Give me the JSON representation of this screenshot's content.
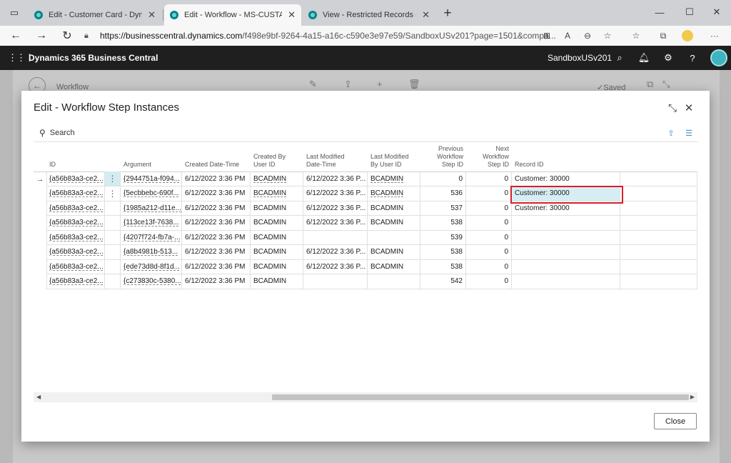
{
  "browser": {
    "tabs": [
      {
        "title": "Edit - Customer Card - Dynamics",
        "active": false
      },
      {
        "title": "Edit - Workflow - MS-CUSTAW-W",
        "active": true
      },
      {
        "title": "View - Restricted Records - Dyna",
        "active": false
      }
    ],
    "url_host": "https://businesscentral.dynamics.com",
    "url_path": "/f498e9bf-9264-4a15-a16c-c590e3e97e59/SandboxUSv201?page=1501&compa..."
  },
  "bc": {
    "app_name": "Dynamics 365 Business Central",
    "environment": "SandboxUSv201"
  },
  "background_page": {
    "title": "Workflow",
    "saved_label": "Saved"
  },
  "dialog": {
    "title": "Edit - Workflow Step Instances",
    "search_label": "Search",
    "close_label": "Close",
    "columns": [
      "ID",
      "Argument",
      "Created Date-Time",
      "Created By\nUser ID",
      "Last Modified\nDate-Time",
      "Last Modified\nBy User ID",
      "Previous\nWorkflow\nStep ID",
      "Next\nWorkflow\nStep ID",
      "Record ID"
    ],
    "rows": [
      {
        "id": "{a56b83a3-ce2...",
        "argument": "{2944751a-f094...",
        "created": "6/12/2022 3:36 PM",
        "created_by": "BCADMIN",
        "modified": "6/12/2022 3:36 P...",
        "modified_by": "BCADMIN",
        "prev": "0",
        "next": "0",
        "record": "Customer: 30000"
      },
      {
        "id": "{a56b83a3-ce2...",
        "argument": "{5ecbbebc-690f...",
        "created": "6/12/2022 3:36 PM",
        "created_by": "BCADMIN",
        "modified": "6/12/2022 3:36 P...",
        "modified_by": "BCADMIN",
        "prev": "536",
        "next": "0",
        "record": "Customer: 30000"
      },
      {
        "id": "{a56b83a3-ce2...",
        "argument": "{1985a212-d11e...",
        "created": "6/12/2022 3:36 PM",
        "created_by": "BCADMIN",
        "modified": "6/12/2022 3:36 P...",
        "modified_by": "BCADMIN",
        "prev": "537",
        "next": "0",
        "record": "Customer: 30000"
      },
      {
        "id": "{a56b83a3-ce2...",
        "argument": "{113ce13f-7638...",
        "created": "6/12/2022 3:36 PM",
        "created_by": "BCADMIN",
        "modified": "6/12/2022 3:36 P...",
        "modified_by": "BCADMIN",
        "prev": "538",
        "next": "0",
        "record": ""
      },
      {
        "id": "{a56b83a3-ce2...",
        "argument": "{4207f724-fb7a-...",
        "created": "6/12/2022 3:36 PM",
        "created_by": "BCADMIN",
        "modified": "",
        "modified_by": "",
        "prev": "539",
        "next": "0",
        "record": ""
      },
      {
        "id": "{a56b83a3-ce2...",
        "argument": "{a8b4981b-513...",
        "created": "6/12/2022 3:36 PM",
        "created_by": "BCADMIN",
        "modified": "6/12/2022 3:36 P...",
        "modified_by": "BCADMIN",
        "prev": "538",
        "next": "0",
        "record": ""
      },
      {
        "id": "{a56b83a3-ce2...",
        "argument": "{ede73d8d-8f1d...",
        "created": "6/12/2022 3:36 PM",
        "created_by": "BCADMIN",
        "modified": "6/12/2022 3:36 P...",
        "modified_by": "BCADMIN",
        "prev": "538",
        "next": "0",
        "record": ""
      },
      {
        "id": "{a56b83a3-ce2...",
        "argument": "{c273830c-5380...",
        "created": "6/12/2022 3:36 PM",
        "created_by": "BCADMIN",
        "modified": "",
        "modified_by": "",
        "prev": "542",
        "next": "0",
        "record": ""
      }
    ]
  },
  "colors": {
    "selected_cell": "#d6eef3",
    "highlight_border": "#d41f2a",
    "bc_bar": "#1f1f1f"
  }
}
